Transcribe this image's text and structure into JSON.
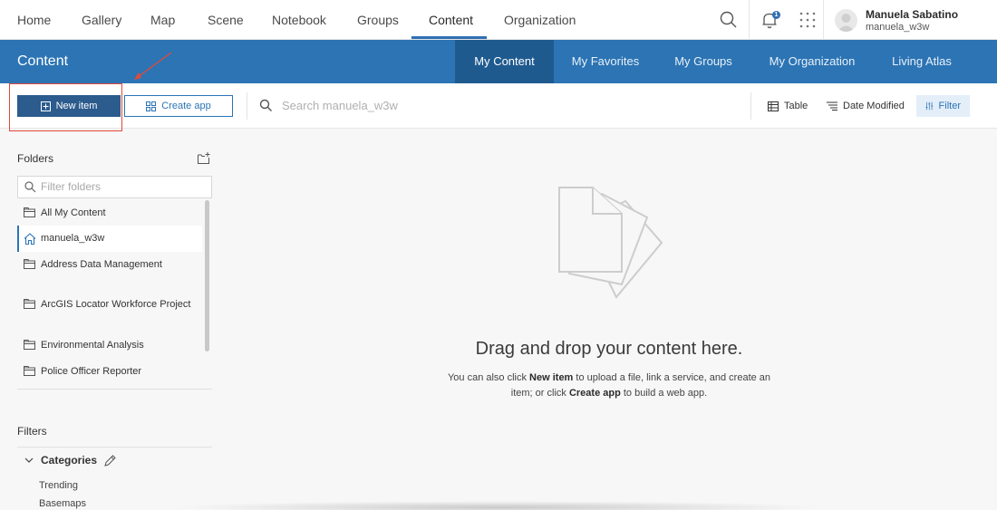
{
  "topnav": {
    "links": [
      "Home",
      "Gallery",
      "Map",
      "Scene",
      "Notebook",
      "Groups",
      "Content",
      "Organization"
    ],
    "active": "Content",
    "notification_count": "1",
    "user_name": "Manuela Sabatino",
    "user_handle": "manuela_w3w"
  },
  "header": {
    "title": "Content",
    "tabs": [
      "My Content",
      "My Favorites",
      "My Groups",
      "My Organization",
      "Living Atlas"
    ],
    "active_tab": "My Content"
  },
  "toolbar": {
    "new_item_label": "New item",
    "create_app_label": "Create app",
    "search_placeholder": "Search manuela_w3w",
    "table_label": "Table",
    "sort_label": "Date Modified",
    "filter_label": "Filter"
  },
  "sidebar": {
    "folders_heading": "Folders",
    "filter_placeholder": "Filter folders",
    "folders": [
      {
        "label": "All My Content",
        "icon": "folder-icon"
      },
      {
        "label": "manuela_w3w",
        "icon": "home-icon",
        "selected": true
      },
      {
        "label": "Address Data Management",
        "icon": "folder-icon"
      },
      {
        "label": "ArcGIS Locator Workforce Project",
        "icon": "folder-icon"
      },
      {
        "label": "Environmental Analysis",
        "icon": "folder-icon"
      },
      {
        "label": "Police Officer Reporter",
        "icon": "folder-icon"
      }
    ],
    "filters_heading": "Filters",
    "categories_label": "Categories",
    "category_items": [
      "Trending",
      "Basemaps"
    ]
  },
  "empty_state": {
    "title": "Drag and drop your content here.",
    "desc_1": "You can also click ",
    "desc_bold_1": "New item",
    "desc_2": " to upload a file, link a service, and create an item; or click ",
    "desc_bold_2": "Create app",
    "desc_3": " to build a web app."
  },
  "colors": {
    "brand_blue": "#2c74b4",
    "active_tab": "#1f5a8f",
    "primary_button": "#2c5b8d",
    "annotation_red": "#e04a3a"
  }
}
